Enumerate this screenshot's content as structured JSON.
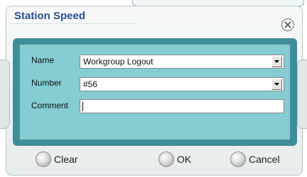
{
  "dialog": {
    "title": "Station Speed"
  },
  "form": {
    "name_label": "Name",
    "name_value": "Workgroup Logout",
    "number_label": "Number",
    "number_value": "#56",
    "comment_label": "Comment",
    "comment_value": ""
  },
  "buttons": {
    "clear": "Clear",
    "ok": "OK",
    "cancel": "Cancel"
  },
  "colors": {
    "title_text": "#2a4f8c",
    "panel_frame": "#3f8d99",
    "panel_fill": "#86cdd3"
  }
}
